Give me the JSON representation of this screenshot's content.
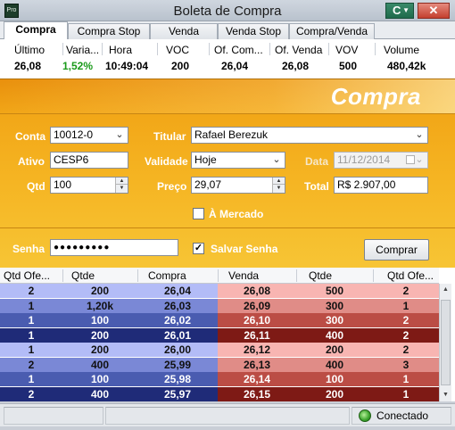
{
  "window": {
    "title": "Boleta de Compra",
    "app_icon": "Pro",
    "c_button": "C",
    "close": "✕"
  },
  "tabs": [
    "Compra",
    "Compra Stop",
    "Venda",
    "Venda Stop",
    "Compra/Venda"
  ],
  "quote": {
    "headers": [
      "Último",
      "Varia...",
      "Hora",
      "VOC",
      "Of. Com...",
      "Of. Venda",
      "VOV",
      "Volume"
    ],
    "values": [
      "26,08",
      "1,52%",
      "10:49:04",
      "200",
      "26,04",
      "26,08",
      "500",
      "480,42k"
    ]
  },
  "order": {
    "banner": "Compra",
    "conta_label": "Conta",
    "conta_value": "10012-0",
    "titular_label": "Titular",
    "titular_value": "Rafael Berezuk",
    "ativo_label": "Ativo",
    "ativo_value": "CESP6",
    "validade_label": "Validade",
    "validade_value": "Hoje",
    "data_label": "Data",
    "data_value": "11/12/2014",
    "qtd_label": "Qtd",
    "qtd_value": "100",
    "preco_label": "Preço",
    "preco_value": "29,07",
    "total_label": "Total",
    "total_value": "R$ 2.907,00",
    "mercado_label": "À Mercado",
    "mercado_checked": false,
    "senha_label": "Senha",
    "senha_value": "●●●●●●●●●",
    "salvar_label": "Salvar Senha",
    "salvar_checked": true,
    "salvar_mark": "✓",
    "comprar_label": "Comprar"
  },
  "book": {
    "headers": [
      "Qtd Ofe...",
      "Qtde",
      "Compra",
      "Venda",
      "Qtde",
      "Qtd Ofe..."
    ],
    "rows": [
      [
        "2",
        "200",
        "26,04",
        "26,08",
        "500",
        "2"
      ],
      [
        "1",
        "1,20k",
        "26,03",
        "26,09",
        "300",
        "1"
      ],
      [
        "1",
        "100",
        "26,02",
        "26,10",
        "300",
        "2"
      ],
      [
        "1",
        "200",
        "26,01",
        "26,11",
        "400",
        "2"
      ],
      [
        "1",
        "200",
        "26,00",
        "26,12",
        "200",
        "2"
      ],
      [
        "2",
        "400",
        "25,99",
        "26,13",
        "400",
        "3"
      ],
      [
        "1",
        "100",
        "25,98",
        "26,14",
        "100",
        "1"
      ],
      [
        "2",
        "400",
        "25,97",
        "26,15",
        "200",
        "1"
      ]
    ],
    "buy_colors": [
      "#b3bcf7",
      "#7a88d6",
      "#4a5cb0",
      "#1f2b78",
      "#b3bcf7",
      "#7a88d6",
      "#4a5cb0",
      "#1f2b78"
    ],
    "sell_colors": [
      "#f8b5b2",
      "#e08c87",
      "#bb4d45",
      "#7e1a15",
      "#f8b5b2",
      "#e08c87",
      "#bb4d45",
      "#7e1a15"
    ]
  },
  "status": {
    "text": "Conectado",
    "led_color": "#3aa32b"
  }
}
